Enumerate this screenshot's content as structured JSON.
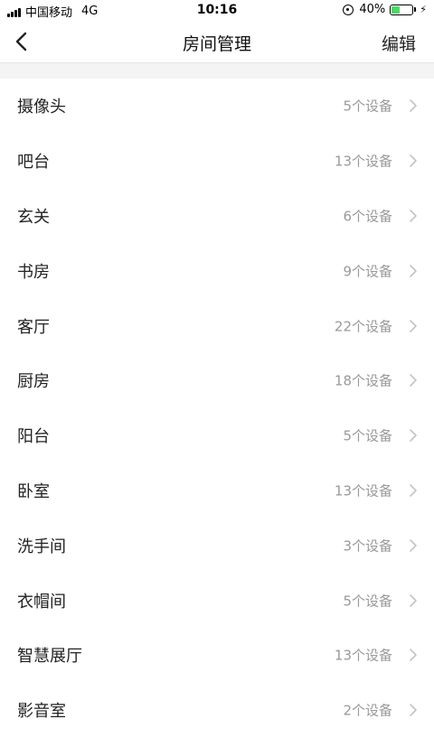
{
  "status_bar": {
    "carrier": "中国移动",
    "network": "4G",
    "time": "10:16",
    "battery": "40%",
    "battery_level": 0.4
  },
  "nav": {
    "title": "房间管理",
    "edit_label": "编辑"
  },
  "rooms": [
    {
      "name": "摄像头",
      "count": "5个设备"
    },
    {
      "name": "吧台",
      "count": "13个设备"
    },
    {
      "name": "玄关",
      "count": "6个设备"
    },
    {
      "name": "书房",
      "count": "9个设备"
    },
    {
      "name": "客厅",
      "count": "22个设备"
    },
    {
      "name": "厨房",
      "count": "18个设备"
    },
    {
      "name": "阳台",
      "count": "5个设备"
    },
    {
      "name": "卧室",
      "count": "13个设备"
    },
    {
      "name": "洗手间",
      "count": "3个设备"
    },
    {
      "name": "衣帽间",
      "count": "5个设备"
    },
    {
      "name": "智慧展厅",
      "count": "13个设备"
    },
    {
      "name": "影音室",
      "count": "2个设备"
    }
  ],
  "colors": {
    "battery_fill": "#4cd964",
    "count_text": "#999999",
    "chevron": "#c4c4c4",
    "divider": "#e4e4e4",
    "gap": "#f4f4f4"
  },
  "icons": {
    "back": "chevron-left-icon",
    "row_arrow": "chevron-right-icon",
    "rotation_lock": "rotation-lock-icon",
    "battery": "battery-icon",
    "charging": "charging-bolt-icon",
    "signal": "signal-bars-icon"
  }
}
